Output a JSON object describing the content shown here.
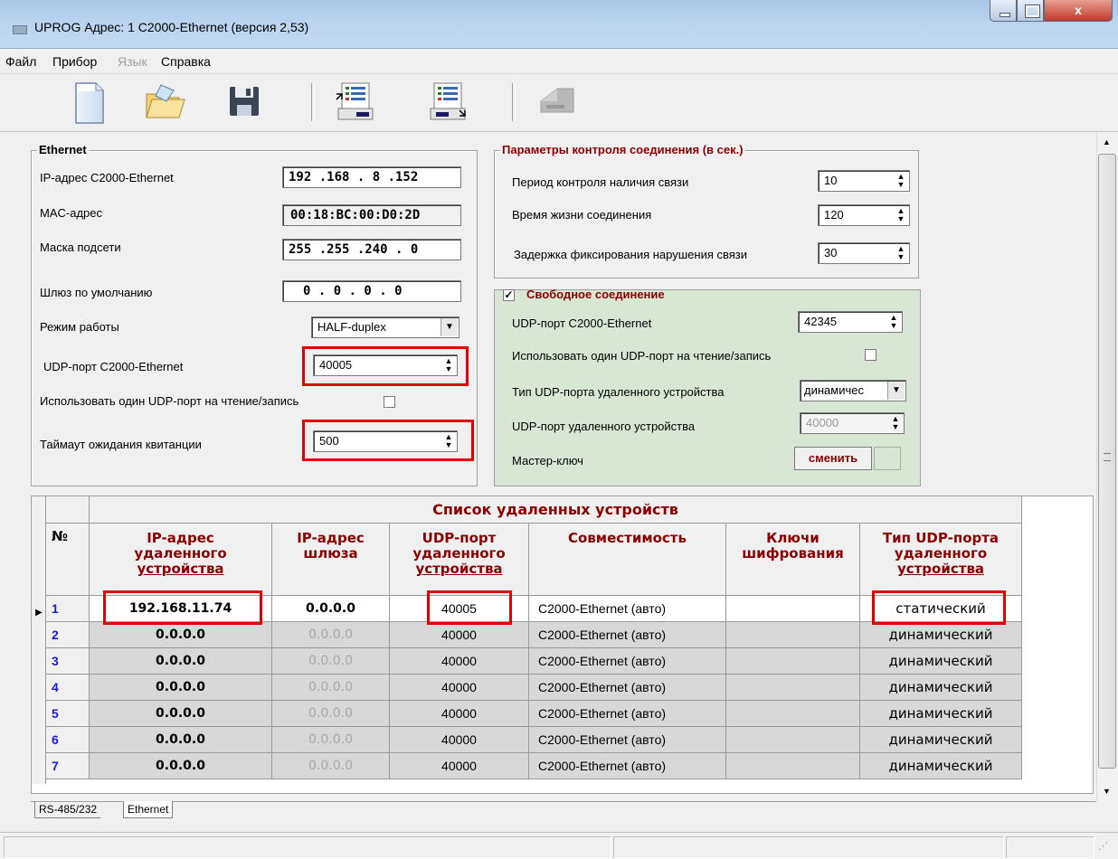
{
  "window": {
    "title": "UPROG  Адрес:  1  C2000-Ethernet (версия  2,53)",
    "close_glyph": "x"
  },
  "menu": [
    "Файл",
    "Прибор",
    "Язык",
    "Справка"
  ],
  "toolbar": {
    "icons": [
      "new-file-icon",
      "open-folder-icon",
      "save-disk-icon",
      "read-device-icon",
      "write-device-icon",
      "device-disabled-icon"
    ]
  },
  "ethernet": {
    "title": "Ethernet",
    "ip_label": "IP-адрес C2000-Ethernet",
    "ip_value": "192 .168 .  8  .152",
    "mac_label": "MAC-адрес",
    "mac_value": "00:18:BC:00:D0:2D",
    "mask_label": "Маска подсети",
    "mask_value": "255 .255 .240 .  0",
    "gateway_label": "Шлюз по умолчанию",
    "gateway_value": "0  .  0  .  0  .  0",
    "mode_label": "Режим работы",
    "mode_value": "HALF-duplex",
    "udp_label": "UDP-порт C2000-Ethernet",
    "udp_value": "40005",
    "single_port_label": "Использовать один UDP-порт на чтение/запись",
    "timeout_label": "Таймаут ожидания квитанции",
    "timeout_value": "500"
  },
  "control": {
    "title": "Параметры контроля соединения (в сек.)",
    "period_label": "Период контроля наличия связи",
    "period_value": "10",
    "lifetime_label": "Время жизни соединения",
    "lifetime_value": "120",
    "delay_label": "Задержка фиксирования нарушения связи",
    "delay_value": "30"
  },
  "free_conn": {
    "title": "Свободное соединение",
    "udp_label": "UDP-порт C2000-Ethernet",
    "udp_value": "42345",
    "single_port_label": "Использовать один UDP-порт на чтение/запись",
    "remote_type_label": "Тип UDP-порта удаленного устройства",
    "remote_type_value": "динамичес",
    "remote_port_label": "UDP-порт удаленного устройства",
    "remote_port_value": "40000",
    "master_key_label": "Мастер-ключ",
    "change_button": "сменить"
  },
  "table": {
    "title": "Список удаленных устройств",
    "headers": [
      "№",
      "IP-адрес удаленного устройства",
      "IP-адрес шлюза",
      "UDP-порт удаленного устройства",
      "Совместимость",
      "Ключи шифрования",
      "Тип UDP-порта удаленного устройства"
    ],
    "header_lines": {
      "ip": [
        "IP-адрес",
        "удаленного",
        "устройства"
      ],
      "gw": [
        "IP-адрес",
        "шлюза"
      ],
      "udp": [
        "UDP-порт",
        "удаленного",
        "устройства"
      ],
      "compat": [
        "Совместимость"
      ],
      "keys": [
        "Ключи",
        "шифрования"
      ],
      "type": [
        "Тип UDP-порта",
        "удаленного",
        "устройства"
      ]
    },
    "rows": [
      {
        "n": "1",
        "ip": "192.168.11.74",
        "gw": "0.0.0.0",
        "udp": "40005",
        "compat": "C2000-Ethernet (авто)",
        "keys": "",
        "type": "статический"
      },
      {
        "n": "2",
        "ip": "0.0.0.0",
        "gw": "0.0.0.0",
        "udp": "40000",
        "compat": "C2000-Ethernet (авто)",
        "keys": "",
        "type": "динамический"
      },
      {
        "n": "3",
        "ip": "0.0.0.0",
        "gw": "0.0.0.0",
        "udp": "40000",
        "compat": "C2000-Ethernet (авто)",
        "keys": "",
        "type": "динамический"
      },
      {
        "n": "4",
        "ip": "0.0.0.0",
        "gw": "0.0.0.0",
        "udp": "40000",
        "compat": "C2000-Ethernet (авто)",
        "keys": "",
        "type": "динамический"
      },
      {
        "n": "5",
        "ip": "0.0.0.0",
        "gw": "0.0.0.0",
        "udp": "40000",
        "compat": "C2000-Ethernet (авто)",
        "keys": "",
        "type": "динамический"
      },
      {
        "n": "6",
        "ip": "0.0.0.0",
        "gw": "0.0.0.0",
        "udp": "40000",
        "compat": "C2000-Ethernet (авто)",
        "keys": "",
        "type": "динамический"
      },
      {
        "n": "7",
        "ip": "0.0.0.0",
        "gw": "0.0.0.0",
        "udp": "40000",
        "compat": "C2000-Ethernet (авто)",
        "keys": "",
        "type": "динамический"
      }
    ],
    "selected_row": 2
  },
  "tabs": [
    "RS-485/232",
    "Ethernet"
  ],
  "colors": {
    "highlight": "#e00000",
    "header_text": "#8b0000",
    "row_number": "#1b1bd8",
    "free_conn_bg": "#d8e7d4"
  }
}
